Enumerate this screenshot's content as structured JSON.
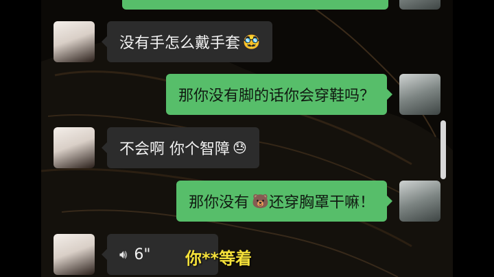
{
  "messages": [
    {
      "side": "right",
      "text": ""
    },
    {
      "side": "left",
      "text": "没有手怎么戴手套",
      "emoji": "🥸"
    },
    {
      "side": "right",
      "text": "那你没有脚的话你会穿鞋吗？"
    },
    {
      "side": "left",
      "text": "不会啊  你个智障",
      "emoji": "😓"
    },
    {
      "side": "right",
      "text": "那你没有",
      "emoji": "🐻",
      "text_after": " 还穿胸罩干嘛！"
    },
    {
      "side": "left",
      "voice_duration": "6\""
    }
  ],
  "subtitle": "你**等着",
  "icons": {
    "voice": "voice-wave-icon"
  }
}
